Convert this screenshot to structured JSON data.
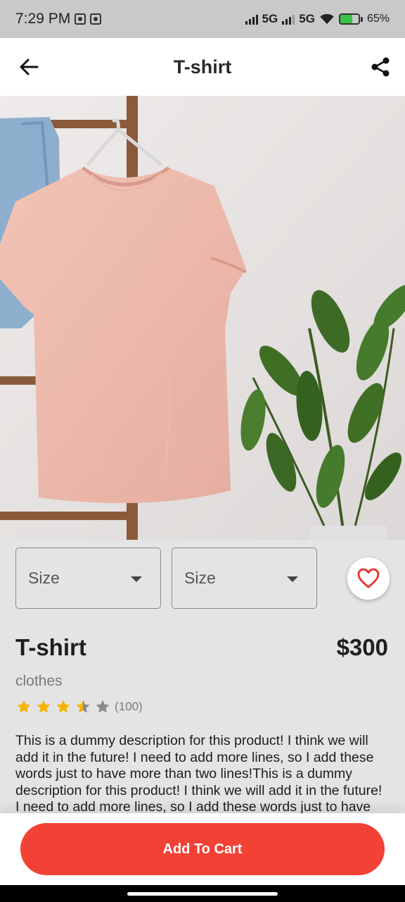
{
  "status_bar": {
    "time": "7:29 PM",
    "network1": "5G",
    "network2": "5G",
    "battery": "65%",
    "battery_level": 0.65,
    "icons": [
      "notification-icon",
      "notification-icon",
      "signal-icon",
      "signal-icon",
      "wifi-icon",
      "battery-icon"
    ]
  },
  "app_bar": {
    "title": "T-shirt",
    "back_icon": "arrow-left-icon",
    "share_icon": "share-icon"
  },
  "product_image": {
    "subject": "product-photo"
  },
  "options": {
    "size1_placeholder": "Size",
    "size2_placeholder": "Size",
    "favorite_icon": "heart-outline-icon"
  },
  "product": {
    "name": "T-shirt",
    "price": "$300",
    "category": "clothes",
    "rating": 3.5,
    "rating_max": 5,
    "rating_count": "(100)",
    "description": "This is a dummy description for this product! I think we will add it in the future! I need to add more lines, so I add these words just to have more than two lines!This is a dummy description for this product! I think we will add it in the future! I need to add more lines, so I add these words just to have more than two lines!"
  },
  "actions": {
    "add_to_cart": "Add To Cart"
  },
  "colors": {
    "accent": "#f24236",
    "star": "#f5b400",
    "star_empty": "#8a8a8a",
    "heart": "#e53935",
    "background": "#e4e4e4"
  }
}
